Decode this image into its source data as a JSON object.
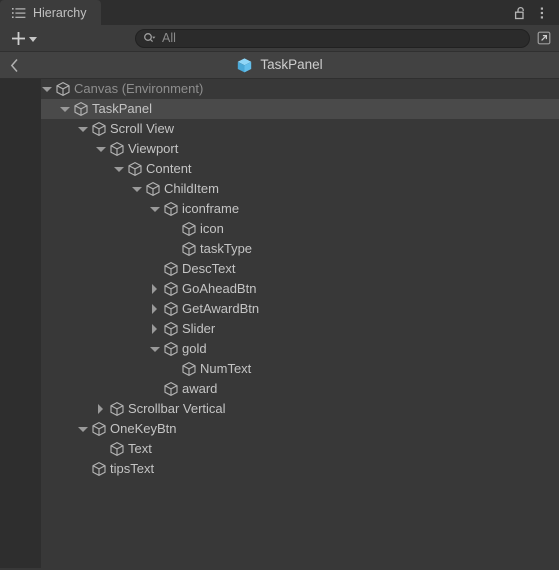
{
  "window": {
    "tab": {
      "label": "Hierarchy",
      "icon": "list-icon"
    },
    "lock_icon": "padlock-open-icon",
    "menu_icon": "kebab-menu-icon"
  },
  "toolbar": {
    "add_label": "+",
    "add_icon": "plus-icon",
    "add_dropdown_icon": "chevron-down-icon",
    "search": {
      "icon": "search-dropdown-icon",
      "value": "",
      "placeholder": "All"
    },
    "open_window_icon": "open-in-new-window-icon"
  },
  "breadcrumb": {
    "back_icon": "chevron-left-icon",
    "prefab_icon": "prefab-cube-icon",
    "prefab_icon_color": "#5ec1ef",
    "label": "TaskPanel"
  },
  "colors": {
    "panel_background": "#383838",
    "gutter": "#2e2e2e",
    "selection": "#4a4a4a",
    "text": "#c4c4c4",
    "text_dim": "#8e8e8e",
    "prefab_blue": "#5ec1ef"
  },
  "tree": {
    "rows": [
      {
        "label": "Canvas (Environment)",
        "depth": 0,
        "twisty": "down",
        "icon": "gameobject-cube-icon",
        "selected": false,
        "dim": true
      },
      {
        "label": "TaskPanel",
        "depth": 1,
        "twisty": "down",
        "icon": "gameobject-cube-icon",
        "selected": true,
        "dim": false
      },
      {
        "label": "Scroll View",
        "depth": 2,
        "twisty": "down",
        "icon": "gameobject-cube-icon",
        "selected": false,
        "dim": false
      },
      {
        "label": "Viewport",
        "depth": 3,
        "twisty": "down",
        "icon": "gameobject-cube-icon",
        "selected": false,
        "dim": false
      },
      {
        "label": "Content",
        "depth": 4,
        "twisty": "down",
        "icon": "gameobject-cube-icon",
        "selected": false,
        "dim": false
      },
      {
        "label": "ChildItem",
        "depth": 5,
        "twisty": "down",
        "icon": "gameobject-cube-icon",
        "selected": false,
        "dim": false
      },
      {
        "label": "iconframe",
        "depth": 6,
        "twisty": "down",
        "icon": "gameobject-cube-icon",
        "selected": false,
        "dim": false
      },
      {
        "label": "icon",
        "depth": 7,
        "twisty": "none",
        "icon": "gameobject-cube-icon",
        "selected": false,
        "dim": false
      },
      {
        "label": "taskType",
        "depth": 7,
        "twisty": "none",
        "icon": "gameobject-cube-icon",
        "selected": false,
        "dim": false
      },
      {
        "label": "DescText",
        "depth": 6,
        "twisty": "none",
        "icon": "gameobject-cube-icon",
        "selected": false,
        "dim": false
      },
      {
        "label": "GoAheadBtn",
        "depth": 6,
        "twisty": "right",
        "icon": "gameobject-cube-icon",
        "selected": false,
        "dim": false
      },
      {
        "label": "GetAwardBtn",
        "depth": 6,
        "twisty": "right",
        "icon": "gameobject-cube-icon",
        "selected": false,
        "dim": false
      },
      {
        "label": "Slider",
        "depth": 6,
        "twisty": "right",
        "icon": "gameobject-cube-icon",
        "selected": false,
        "dim": false
      },
      {
        "label": "gold",
        "depth": 6,
        "twisty": "down",
        "icon": "gameobject-cube-icon",
        "selected": false,
        "dim": false
      },
      {
        "label": "NumText",
        "depth": 7,
        "twisty": "none",
        "icon": "gameobject-cube-icon",
        "selected": false,
        "dim": false
      },
      {
        "label": "award",
        "depth": 6,
        "twisty": "none",
        "icon": "gameobject-cube-icon",
        "selected": false,
        "dim": false
      },
      {
        "label": "Scrollbar Vertical",
        "depth": 3,
        "twisty": "right",
        "icon": "gameobject-cube-icon",
        "selected": false,
        "dim": false
      },
      {
        "label": "OneKeyBtn",
        "depth": 2,
        "twisty": "down",
        "icon": "gameobject-cube-icon",
        "selected": false,
        "dim": false
      },
      {
        "label": "Text",
        "depth": 3,
        "twisty": "none",
        "icon": "gameobject-cube-icon",
        "selected": false,
        "dim": false
      },
      {
        "label": "tipsText",
        "depth": 2,
        "twisty": "none",
        "icon": "gameobject-cube-icon",
        "selected": false,
        "dim": false
      }
    ]
  }
}
